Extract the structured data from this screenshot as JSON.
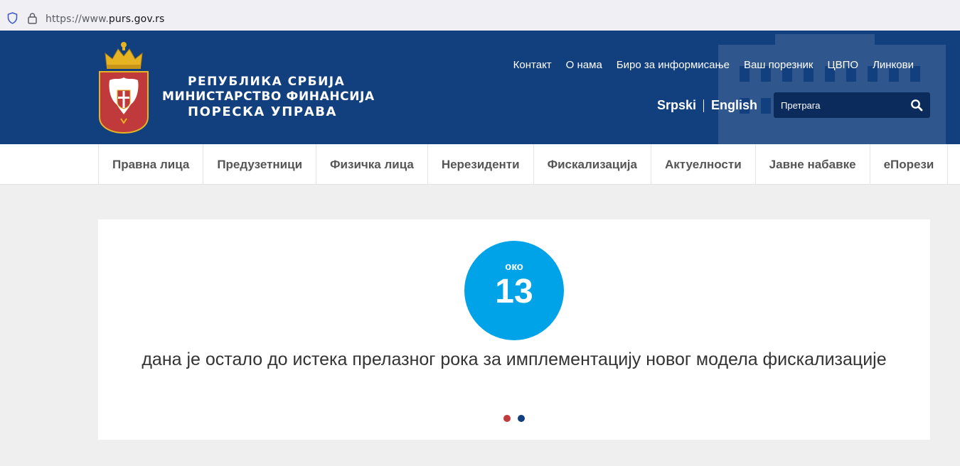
{
  "browser": {
    "url_scheme": "https://www.",
    "url_host": "purs.gov.rs"
  },
  "header": {
    "logo_line1": "Република Србија",
    "logo_line2": "Министарство Финансија",
    "logo_line3": "ПОРЕСКА УПРАВА",
    "top_links": [
      "Контакт",
      "О нама",
      "Биро за информисање",
      "Ваш порезник",
      "ЦВПО",
      "Линкови"
    ],
    "lang_sr": "Srpski",
    "lang_en": "English",
    "search_placeholder": "Претрага",
    "bg_color": "#123f7e"
  },
  "menu": {
    "items": [
      "Правна лица",
      "Предузетници",
      "Физичка лица",
      "Нерезиденти",
      "Фискализација",
      "Актуелности",
      "Јавне набавке",
      "еПорези"
    ]
  },
  "slider": {
    "circle_top": "око",
    "circle_number": "13",
    "text": "дана је остало до истека прелазног рока за имплементацију новог модела фискализације",
    "circle_color": "#00a3e8",
    "dot_colors": [
      "#c0393b",
      "#123f7e"
    ]
  }
}
